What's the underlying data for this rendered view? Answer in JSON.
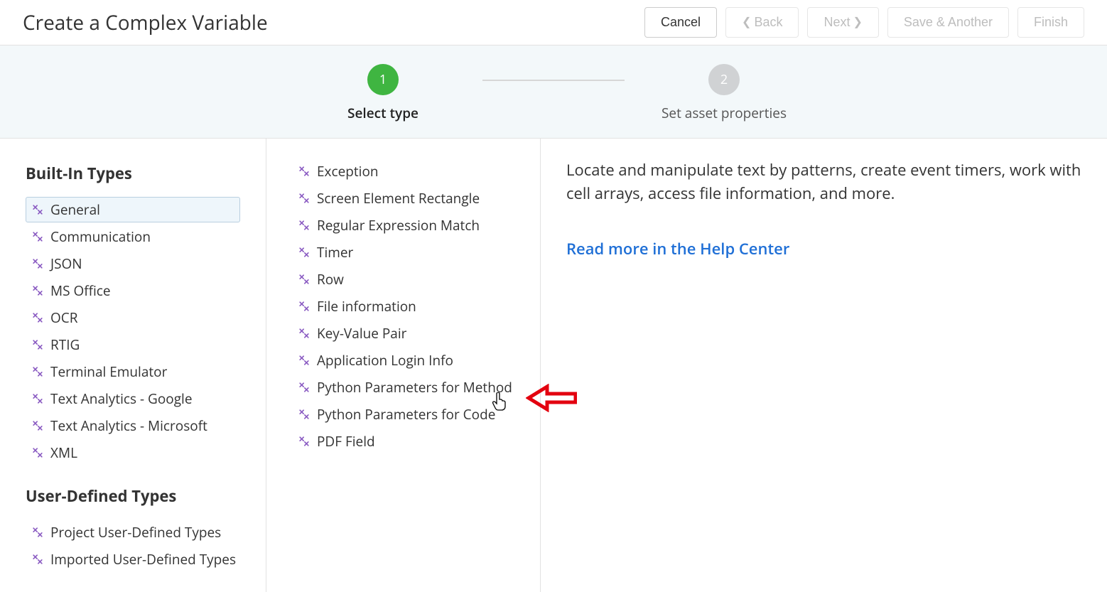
{
  "title": "Create a Complex Variable",
  "buttons": {
    "cancel": "Cancel",
    "back": "Back",
    "next": "Next",
    "save_another": "Save & Another",
    "finish": "Finish"
  },
  "steps": [
    {
      "num": "1",
      "label": "Select type"
    },
    {
      "num": "2",
      "label": "Set asset properties"
    }
  ],
  "sidebar": {
    "section_builtin": "Built-In Types",
    "builtin_items": [
      "General",
      "Communication",
      "JSON",
      "MS Office",
      "OCR",
      "RTIG",
      "Terminal Emulator",
      "Text Analytics - Google",
      "Text Analytics - Microsoft",
      "XML"
    ],
    "section_user": "User-Defined Types",
    "user_items": [
      "Project User-Defined Types",
      "Imported User-Defined Types"
    ]
  },
  "type_list": [
    "Exception",
    "Screen Element Rectangle",
    "Regular Expression Match",
    "Timer",
    "Row",
    "File information",
    "Key-Value Pair",
    "Application Login Info",
    "Python Parameters for Method",
    "Python Parameters for Code",
    "PDF Field"
  ],
  "description": "Locate and manipulate text by patterns, create event timers, work with cell arrays, access file information, and more.",
  "help_link": "Read more in the Help Center"
}
